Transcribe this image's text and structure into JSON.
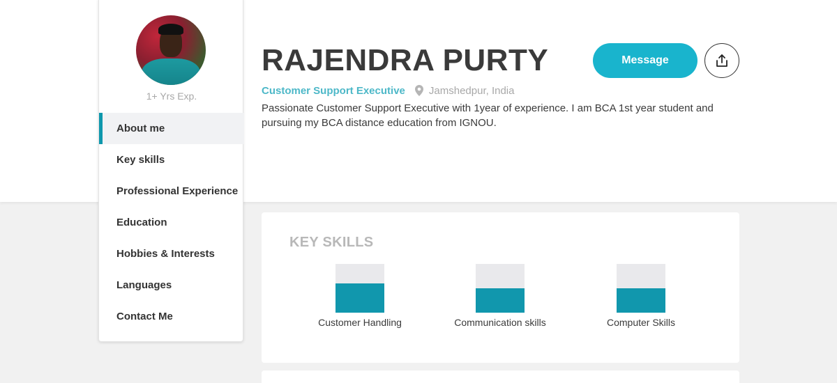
{
  "profile": {
    "name": "RAJENDRA PURTY",
    "experience": "1+ Yrs Exp.",
    "role": "Customer Support Executive",
    "location": "Jamshedpur, India",
    "bio": "Passionate Customer Support Executive with 1year of experience. I am BCA 1st year student and pursuing my BCA distance education from IGNOU."
  },
  "actions": {
    "message_label": "Message",
    "share_icon": "share-upload-icon"
  },
  "sidebar": {
    "items": [
      {
        "label": "About me",
        "active": true
      },
      {
        "label": "Key skills",
        "active": false
      },
      {
        "label": "Professional Experience",
        "active": false
      },
      {
        "label": "Education",
        "active": false
      },
      {
        "label": "Hobbies & Interests",
        "active": false
      },
      {
        "label": "Languages",
        "active": false
      },
      {
        "label": "Contact Me",
        "active": false
      }
    ]
  },
  "key_skills": {
    "title": "KEY SKILLS",
    "items": [
      {
        "label": "Customer Handling",
        "level": 0.6
      },
      {
        "label": "Communication skills",
        "level": 0.5
      },
      {
        "label": "Computer Skills",
        "level": 0.5
      }
    ]
  },
  "colors": {
    "accent": "#19b4cd",
    "skill_fill": "#1197ad",
    "role_text": "#4db8c8",
    "active_nav_border": "#0e98ad"
  }
}
